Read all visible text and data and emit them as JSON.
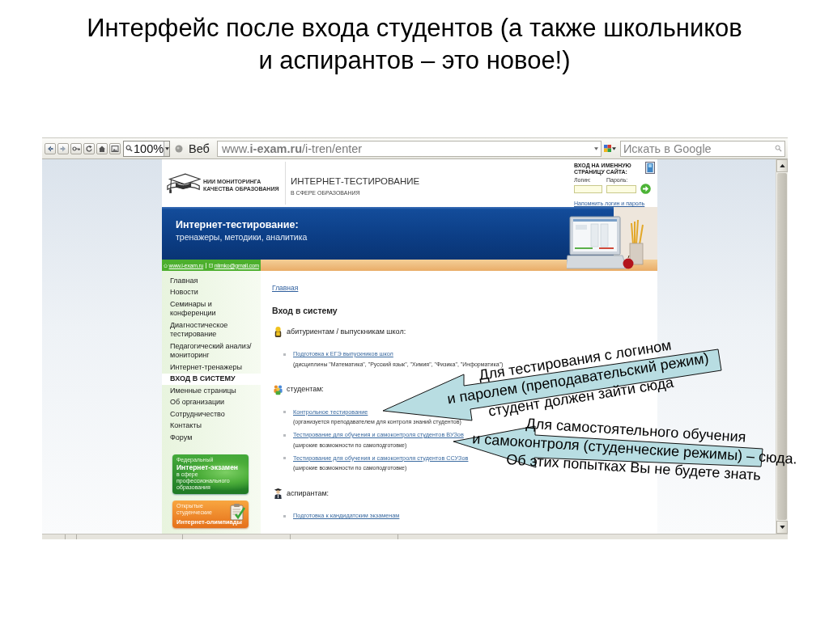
{
  "slide": {
    "title_lines": [
      "Интерфейс после входа студентов (а также школьников",
      "и аспирантов – это новое!)"
    ]
  },
  "browser": {
    "toolbar": {
      "zoom": "100%",
      "search_type": "Веб",
      "url": "www.**i-exam.ru**/i-tren/enter",
      "search_placeholder": "Искать в Google"
    }
  },
  "site": {
    "header": {
      "org_lines": [
        "НИИ МОНИТОРИНГА",
        "КАЧЕСТВА ОБРАЗОВАНИЯ"
      ],
      "title": "ИНТЕРНЕТ-ТЕСТИРОВАНИЕ",
      "subtitle": "В СФЕРЕ ОБРАЗОВАНИЯ",
      "login": {
        "title_lines": [
          "ВХОД НА ИМЕННУЮ",
          "СТРАНИЦУ САЙТА:"
        ],
        "login_label": "Логин:",
        "password_label": "Пароль:",
        "remind_link": "Напомнить логин и пароль"
      }
    },
    "banner": {
      "title": "Интернет-тестирование:",
      "subtitle": "тренажеры, методики, аналитика"
    },
    "sidebar": {
      "site_link": "www.i-exam.ru",
      "email_link": "niimko@gmail.com",
      "menu": [
        {
          "label": "Главная",
          "selected": false
        },
        {
          "label": "Новости",
          "selected": false
        },
        {
          "label": "Семинары и конференции",
          "selected": false
        },
        {
          "label": "Диагностическое тестирование",
          "selected": false
        },
        {
          "label": "Педагогический анализ/ мониторинг",
          "selected": false
        },
        {
          "label": "Интернет-тренажеры",
          "selected": false
        },
        {
          "label": "ВХОД В СИСТЕМУ",
          "selected": true
        },
        {
          "label": "Именные страницы",
          "selected": false
        },
        {
          "label": "Об организации",
          "selected": false
        },
        {
          "label": "Сотрудничество",
          "selected": false
        },
        {
          "label": "Контакты",
          "selected": false
        },
        {
          "label": "Форум",
          "selected": false
        }
      ],
      "promos": [
        {
          "kind": "map",
          "kicker": "Федеральный",
          "title": "Интернет-экзамен",
          "note": "в сфере профессионального образования"
        },
        {
          "kind": "clipboard",
          "kicker": "Открытые студенческие",
          "title": "Интернет-олимпиады"
        }
      ]
    },
    "content": {
      "breadcrumb": "Главная",
      "heading": "Вход в систему",
      "sections": [
        {
          "kind": "single",
          "label": "абитуриентам / выпускникам школ:",
          "items": [
            {
              "link": "Подготовка к ЕГЭ выпускников школ",
              "note": "(дисциплины \"Математика\", \"Русский язык\", \"Химия\", \"Физика\", \"Информатика\")"
            }
          ]
        },
        {
          "kind": "group",
          "label": "студентам:",
          "items": [
            {
              "link": "Контрольное тестирование",
              "note": "(организуется преподавателем для контроля знаний студентов)"
            },
            {
              "link": "Тестирование для обучения и самоконтроля студентов ВУЗов",
              "note": "(широкие возможности по самоподготовке)"
            },
            {
              "link": "Тестирование для обучения и самоконтроля студентов ССУЗов",
              "note": "(широкие возможности по самоподготовке)"
            }
          ]
        },
        {
          "kind": "graduate",
          "label": "аспирантам:",
          "items": [
            {
              "link": "Подготовка к кандидатским экзаменам"
            }
          ]
        }
      ]
    }
  },
  "callouts": [
    {
      "lines": [
        "Для тестирования с логином",
        "и паролем (преподавательский режим)",
        "студент должен зайти сюда"
      ]
    },
    {
      "lines": [
        "Для самостоятельного обучения",
        "и самоконтроля (студенческие режимы) – сюда.",
        "Об этих попытках Вы не будете знать"
      ]
    }
  ]
}
